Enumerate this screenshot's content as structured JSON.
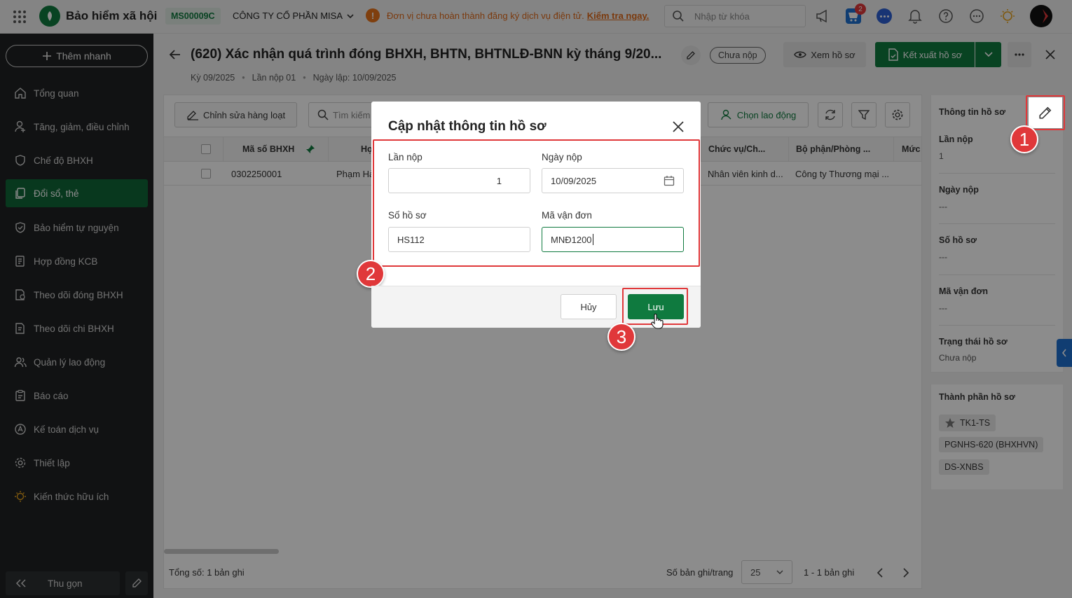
{
  "topbar": {
    "app_title": "Bảo hiểm xã hội",
    "company_code": "MS00009C",
    "company_name": "CÔNG TY CỔ PHẦN MISA",
    "warning_text": "Đơn vị chưa hoàn thành đăng ký dịch vụ điện tử.",
    "warning_link": "Kiểm tra ngay.",
    "search_placeholder": "Nhập từ khóa",
    "cart_badge": "2"
  },
  "sidebar": {
    "add_label": "Thêm nhanh",
    "items": [
      {
        "label": "Tổng quan",
        "icon": "home-icon"
      },
      {
        "label": "Tăng, giảm, điều chỉnh",
        "icon": "user-adjust-icon"
      },
      {
        "label": "Chế độ BHXH",
        "icon": "shield-heart-icon"
      },
      {
        "label": "Đổi sổ, thẻ",
        "icon": "cards-icon"
      },
      {
        "label": "Bảo hiểm tự nguyện",
        "icon": "shield-icon"
      },
      {
        "label": "Hợp đồng KCB",
        "icon": "contract-icon"
      },
      {
        "label": "Theo dõi đóng BHXH",
        "icon": "doc-track-icon"
      },
      {
        "label": "Theo dõi chi BHXH",
        "icon": "doc-pay-icon"
      },
      {
        "label": "Quản lý lao động",
        "icon": "users-icon"
      },
      {
        "label": "Báo cáo",
        "icon": "report-icon"
      },
      {
        "label": "Kế toán dịch vụ",
        "icon": "accounting-icon"
      },
      {
        "label": "Thiết lập",
        "icon": "gear-icon"
      },
      {
        "label": "Kiến thức hữu ích",
        "icon": "lightbulb-icon"
      }
    ],
    "collapse_label": "Thu gọn"
  },
  "header": {
    "title": "(620) Xác nhận quá trình đóng BHXH, BHTN, BHTNLĐ-BNN kỳ tháng 9/20...",
    "status": "Chưa nộp",
    "view_label": "Xem hồ sơ",
    "export_label": "Kết xuất hồ sơ",
    "period": "Kỳ 09/2025",
    "submission": "Lần nộp 01",
    "created": "Ngày lập: 10/09/2025"
  },
  "toolbar": {
    "bulk_edit_label": "Chỉnh sửa hàng loạt",
    "search_placeholder": "Tìm kiếm",
    "choose_worker_label": "Chọn lao động"
  },
  "table": {
    "columns": [
      "Mã số BHXH",
      "Họ",
      "Chức vụ/Ch...",
      "Bộ phận/Phòng ...",
      "Mức"
    ],
    "rows": [
      {
        "code": "0302250001",
        "name": "Phạm Hà",
        "position": "Nhân viên kinh d...",
        "department": "Công ty Thương mại ..."
      }
    ]
  },
  "footer": {
    "total": "Tổng số: 1 bản ghi",
    "per_page_label": "Số bản ghi/trang",
    "per_page_value": "25",
    "range": "1 - 1 bản ghi"
  },
  "right_panel": {
    "title": "Thông tin hồ sơ",
    "fields": [
      {
        "label": "Lần nộp",
        "value": "1"
      },
      {
        "label": "Ngày nộp",
        "value": "---"
      },
      {
        "label": "Số hồ sơ",
        "value": "---"
      },
      {
        "label": "Mã vận đơn",
        "value": "---"
      },
      {
        "label": "Trạng thái hồ sơ",
        "value": "Chưa nộp"
      }
    ],
    "components_title": "Thành phần hồ sơ",
    "components": [
      "TK1-TS",
      "PGNHS-620 (BHXHVN)",
      "DS-XNBS"
    ]
  },
  "modal": {
    "title": "Cập nhật thông tin hồ sơ",
    "lan_nop_label": "Lần nộp",
    "lan_nop_value": "1",
    "ngay_nop_label": "Ngày nộp",
    "ngay_nop_value": "10/09/2025",
    "so_ho_so_label": "Số hồ sơ",
    "so_ho_so_value": "HS112",
    "ma_van_don_label": "Mã vận đơn",
    "ma_van_don_value": "MNĐ1200",
    "cancel_label": "Hủy",
    "save_label": "Lưu"
  },
  "steps": [
    "1",
    "2",
    "3"
  ],
  "colors": {
    "brand_green": "#0f7a3f",
    "accent_red": "#e0383a",
    "sidebar_bg": "#1f2223"
  }
}
